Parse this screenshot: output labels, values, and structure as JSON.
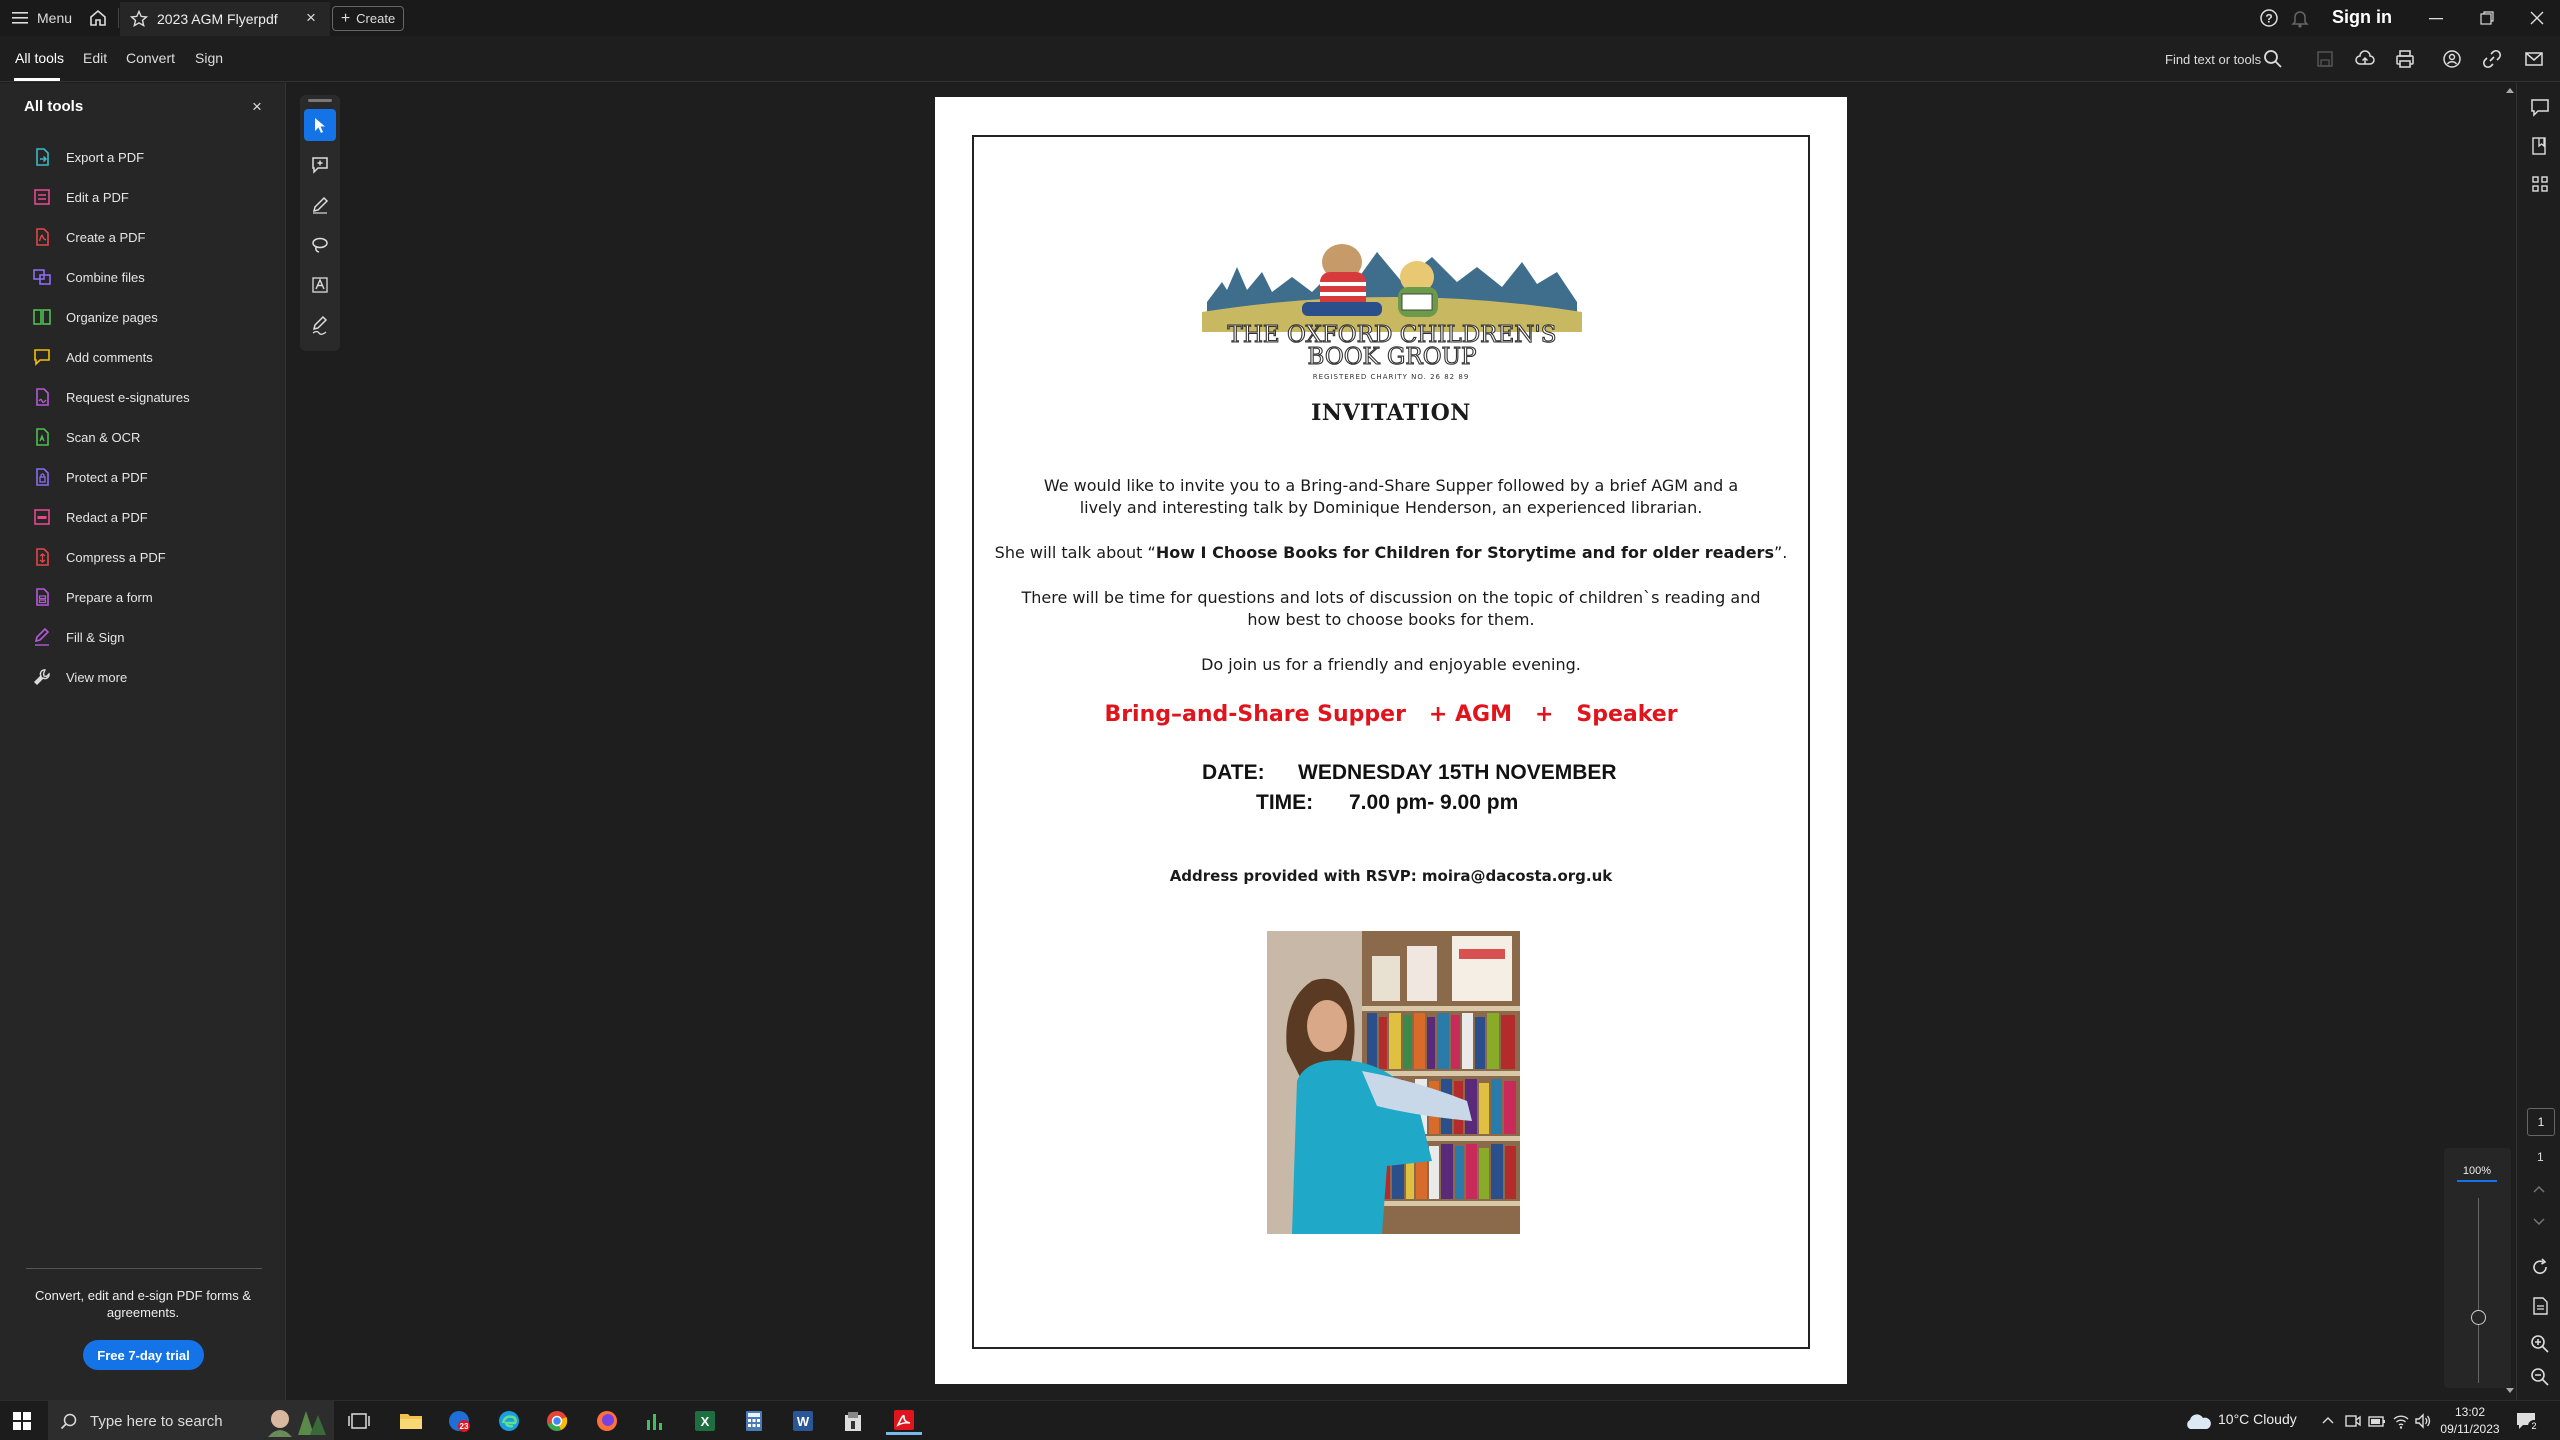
{
  "titlebar": {
    "menu_label": "Menu",
    "tab_title": "2023 AGM Flyerpdf",
    "tab_close": "×",
    "create_label": "Create",
    "sign_in": "Sign in"
  },
  "menubar": {
    "items": [
      "All tools",
      "Edit",
      "Convert",
      "Sign"
    ],
    "find_label": "Find text or tools"
  },
  "left_panel": {
    "title": "All tools",
    "close": "×",
    "items": [
      {
        "label": "Export a PDF",
        "icon": "export-pdf-icon",
        "color": "#3fb8c8"
      },
      {
        "label": "Edit a PDF",
        "icon": "edit-pdf-icon",
        "color": "#e34890"
      },
      {
        "label": "Create a PDF",
        "icon": "create-pdf-icon",
        "color": "#e04848"
      },
      {
        "label": "Combine files",
        "icon": "combine-files-icon",
        "color": "#8a6cf0"
      },
      {
        "label": "Organize pages",
        "icon": "organize-pages-icon",
        "color": "#4fbf4f"
      },
      {
        "label": "Add comments",
        "icon": "add-comments-icon",
        "color": "#f2c100"
      },
      {
        "label": "Request e-signatures",
        "icon": "request-esignatures-icon",
        "color": "#b45ad8"
      },
      {
        "label": "Scan & OCR",
        "icon": "scan-ocr-icon",
        "color": "#4fbf4f"
      },
      {
        "label": "Protect a PDF",
        "icon": "protect-pdf-icon",
        "color": "#8a6cf0"
      },
      {
        "label": "Redact a PDF",
        "icon": "redact-pdf-icon",
        "color": "#e34890"
      },
      {
        "label": "Compress a PDF",
        "icon": "compress-pdf-icon",
        "color": "#e04848"
      },
      {
        "label": "Prepare a form",
        "icon": "prepare-form-icon",
        "color": "#b45ad8"
      },
      {
        "label": "Fill & Sign",
        "icon": "fill-sign-icon",
        "color": "#b45ad8"
      },
      {
        "label": "View more",
        "icon": "view-more-icon",
        "color": "#dddddd"
      }
    ],
    "promo": "Convert, edit and e-sign PDF forms & agreements.",
    "trial_button": "Free 7-day trial"
  },
  "document": {
    "logo_text_line1": "THE OXFORD CHILDREN'S",
    "logo_text_line2": "BOOK GROUP",
    "logo_small": "REGISTERED CHARITY NO. 26 82 89",
    "heading": "INVITATION",
    "para1_line1": "We would like to invite you to a Bring-and-Share Supper followed by a brief AGM and a",
    "para1_line2": "lively and interesting talk by Dominique Henderson, an experienced librarian.",
    "para2_prefix": "She will talk about “",
    "para2_bold": "How I Choose Books for Children for Storytime and for older readers",
    "para2_suffix": "”.",
    "para3_line1": "There will be time for questions and lots of discussion on the topic of children`s reading and",
    "para3_line2": "how best to choose books for them.",
    "para4": "Do join us for a friendly and enjoyable evening.",
    "red_line": "Bring–and-Share Supper   + AGM   +   Speaker",
    "date_label": "DATE:",
    "date_value": "WEDNESDAY 15TH NOVEMBER",
    "time_label": "TIME:",
    "time_value": "7.00 pm- 9.00 pm",
    "address": "Address provided with RSVP: moira@dacosta.org.uk"
  },
  "right_rail": {
    "page_current": "1",
    "page_total": "1",
    "zoom": "100%"
  },
  "taskbar": {
    "search_placeholder": "Type here to search",
    "weather": "10°C  Cloudy",
    "time": "13:02",
    "date": "09/11/2023",
    "mail_badge": "23",
    "notif_count": "2"
  },
  "colors": {
    "accent": "#1473e6",
    "red_text": "#e0141c"
  }
}
